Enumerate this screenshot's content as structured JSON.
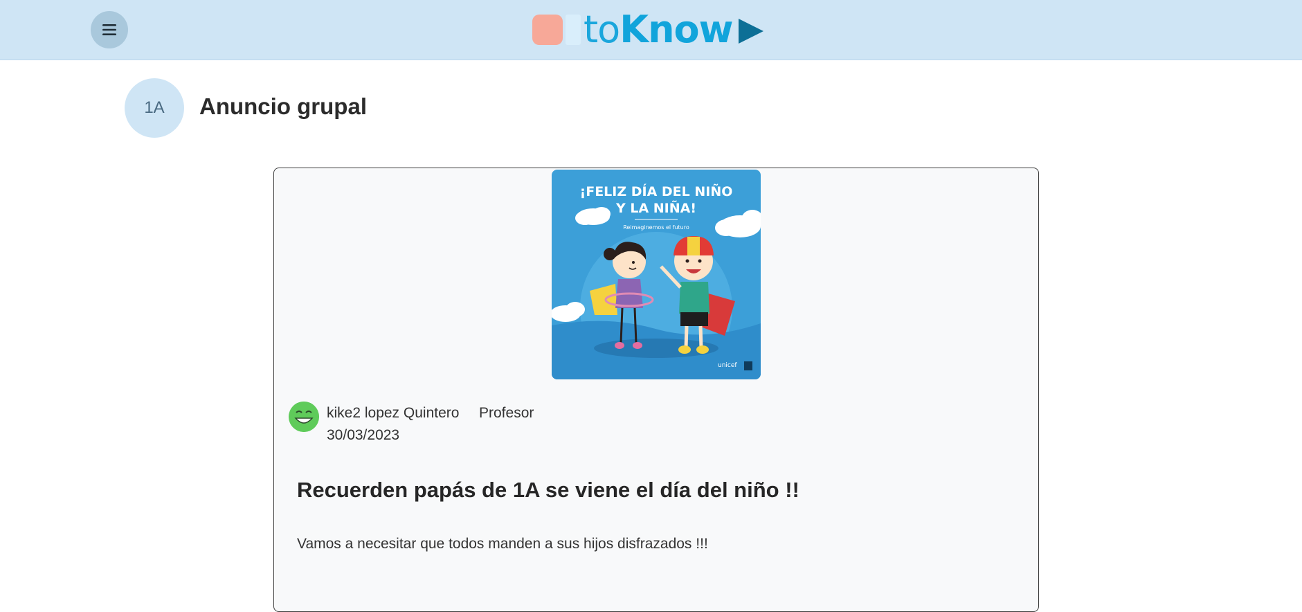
{
  "header": {
    "menu_icon": "hamburger-icon",
    "logo": {
      "text_light": "to",
      "text_bold": "Know",
      "colors": {
        "pill": "#f7a898",
        "text": "#1aa6dc",
        "play": "#0d6f96"
      }
    },
    "background": "#cfe5f5"
  },
  "group": {
    "badge": "1A",
    "title": "Anuncio grupal"
  },
  "post": {
    "image": {
      "headline_line1": "¡FELIZ DÍA DEL NIÑO",
      "headline_line2": "Y LA NIÑA!",
      "tagline": "Reimaginemos el futuro",
      "brand": "unicef"
    },
    "author": {
      "name": "kike2 lopez Quintero",
      "role": "Profesor",
      "avatar_icon": "smiley-avatar-icon"
    },
    "date": "30/03/2023",
    "title": "Recuerden papás de 1A se viene el día del niño !!",
    "body": "Vamos a necesitar que todos manden a sus hijos disfrazados !!!"
  }
}
